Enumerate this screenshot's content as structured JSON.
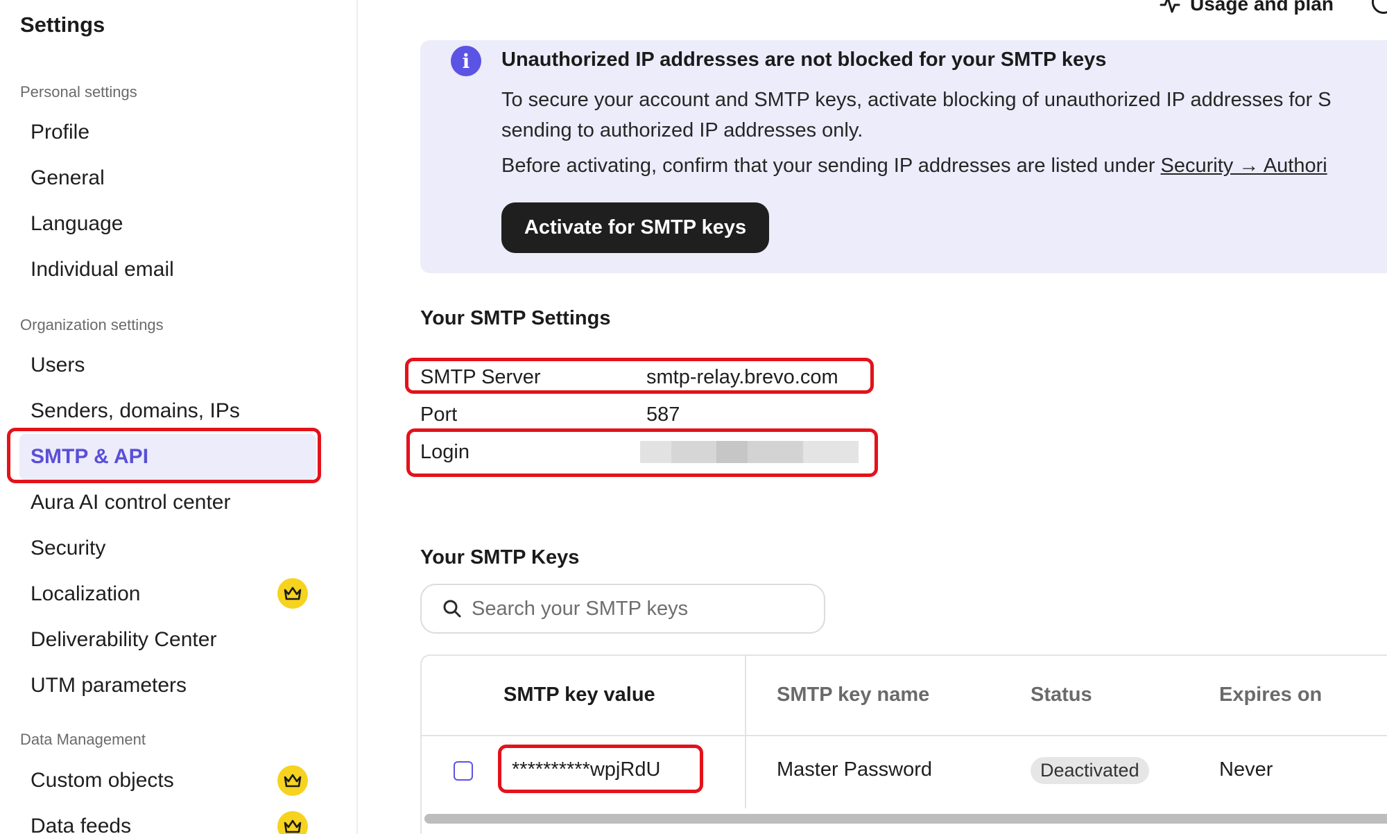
{
  "sidebar": {
    "title": "Settings",
    "groups": [
      {
        "label": "Personal settings"
      },
      {
        "label": "Organization settings"
      },
      {
        "label": "Data Management"
      }
    ],
    "items": [
      {
        "label": "Profile"
      },
      {
        "label": "General"
      },
      {
        "label": "Language"
      },
      {
        "label": "Individual email"
      },
      {
        "label": "Users"
      },
      {
        "label": "Senders, domains, IPs"
      },
      {
        "label": "SMTP & API"
      },
      {
        "label": "Aura AI control center"
      },
      {
        "label": "Security"
      },
      {
        "label": "Localization"
      },
      {
        "label": "Deliverability Center"
      },
      {
        "label": "UTM parameters"
      },
      {
        "label": "Custom objects"
      },
      {
        "label": "Data feeds"
      }
    ]
  },
  "header": {
    "usage_label": "Usage and plan"
  },
  "banner": {
    "title": "Unauthorized IP addresses are not blocked for your SMTP keys",
    "line1": "To secure your account and SMTP keys, activate blocking of unauthorized IP addresses for S",
    "line2": "sending to authorized IP addresses only.",
    "line3_prefix": "Before activating, confirm that your sending IP addresses are listed under ",
    "line3_link": "Security → Authori",
    "button_label": "Activate for SMTP keys"
  },
  "smtp_settings": {
    "title": "Your SMTP Settings",
    "server_label": "SMTP Server",
    "server_value": "smtp-relay.brevo.com",
    "port_label": "Port",
    "port_value": "587",
    "login_label": "Login"
  },
  "smtp_keys": {
    "title": "Your SMTP Keys",
    "search_placeholder": "Search your SMTP keys",
    "columns": [
      "SMTP key value",
      "SMTP key name",
      "Status",
      "Expires on"
    ],
    "rows": [
      {
        "key_value": "**********wpjRdU",
        "key_name": "Master Password",
        "status": "Deactivated",
        "expires": "Never"
      }
    ]
  },
  "colors": {
    "accent": "#5b53e3",
    "highlight": "#e3121b",
    "crown": "#f6d31f"
  }
}
